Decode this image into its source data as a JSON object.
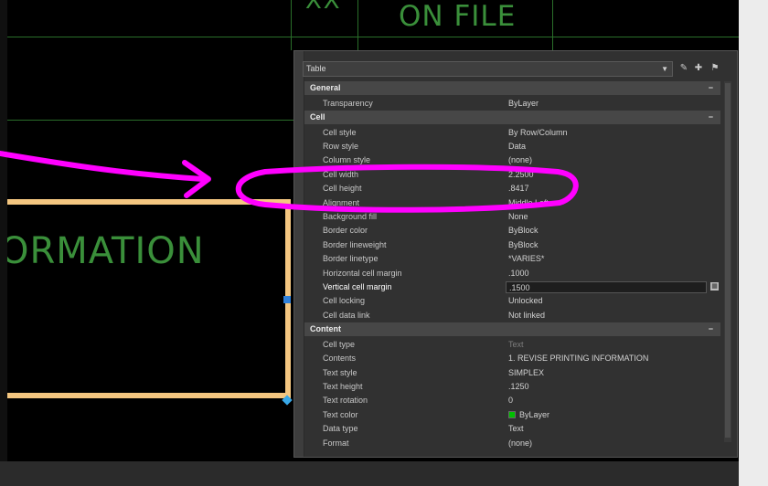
{
  "drawing": {
    "top_label_left": "XX",
    "top_label_right": "ON FILE",
    "frame_text": "ORMATION",
    "colors": {
      "cad_green": "#3a8f3a",
      "frame_orange": "#f4c680",
      "annotation_magenta": "#ff00ff"
    }
  },
  "palette": {
    "selector_label": "Table",
    "toolbar_icons": [
      "quick-select-icon",
      "select-objects-icon",
      "toggle-pickadd-icon"
    ],
    "sections": [
      {
        "title": "General",
        "toggle": "−",
        "rows": [
          {
            "name": "Transparency",
            "value": "ByLayer"
          }
        ]
      },
      {
        "title": "Cell",
        "toggle": "−",
        "rows": [
          {
            "name": "Cell style",
            "value": "By Row/Column"
          },
          {
            "name": "Row style",
            "value": "Data"
          },
          {
            "name": "Column style",
            "value": "(none)"
          },
          {
            "name": "Cell width",
            "value": "2.2500"
          },
          {
            "name": "Cell height",
            "value": ".8417"
          },
          {
            "name": "Alignment",
            "value": "Middle Left"
          },
          {
            "name": "Background fill",
            "value": "None"
          },
          {
            "name": "Border color",
            "value": "ByBlock"
          },
          {
            "name": "Border lineweight",
            "value": "ByBlock"
          },
          {
            "name": "Border linetype",
            "value": "*VARIES*"
          },
          {
            "name": "Horizontal cell margin",
            "value": ".1000"
          },
          {
            "name": "Vertical cell margin",
            "value": ".1500",
            "active": true
          },
          {
            "name": "Cell locking",
            "value": "Unlocked"
          },
          {
            "name": "Cell data link",
            "value": "Not linked"
          }
        ]
      },
      {
        "title": "Content",
        "toggle": "−",
        "rows": [
          {
            "name": "Cell type",
            "value": "Text",
            "dim": true
          },
          {
            "name": "Contents",
            "value": "1. REVISE PRINTING INFORMATION"
          },
          {
            "name": "Text style",
            "value": "SIMPLEX"
          },
          {
            "name": "Text height",
            "value": ".1250"
          },
          {
            "name": "Text rotation",
            "value": "0"
          },
          {
            "name": "Text color",
            "value": "ByLayer",
            "swatch": "#00c000"
          },
          {
            "name": "Data type",
            "value": "Text"
          },
          {
            "name": "Format",
            "value": "(none)"
          }
        ]
      }
    ]
  }
}
